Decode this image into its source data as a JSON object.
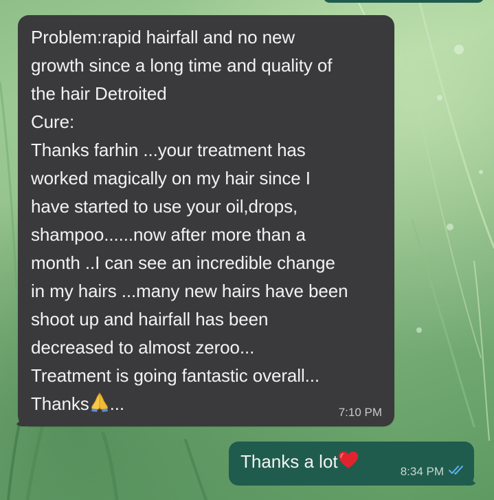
{
  "chat": {
    "incoming": {
      "lines": [
        "Problem:rapid hairfall and   no new",
        "growth since a long time and quality of",
        "the hair Detroited",
        "Cure:",
        "Thanks farhin ...your treatment has",
        "worked magically on my hair since I",
        "have started to use your oil,drops,",
        "shampoo......now after more than a",
        "month ..I can see an incredible change",
        "in my hairs ...many new hairs have been",
        "shoot up and hairfall has been",
        "decreased to almost zeroo...",
        "Treatment is going fantastic overall...",
        "Thanks"
      ],
      "last_line_suffix": "...",
      "emoji": "folded-hands-emoji",
      "time": "7:10 PM"
    },
    "outgoing": {
      "text": "Thanks a lot",
      "emoji": "red-heart-emoji",
      "time": "8:34 PM",
      "status": "read-double-check-icon"
    }
  },
  "colors": {
    "incoming_bubble": "#3a3a3c",
    "outgoing_bubble": "#1f5c4d",
    "read_tick": "#5fb3f5"
  }
}
